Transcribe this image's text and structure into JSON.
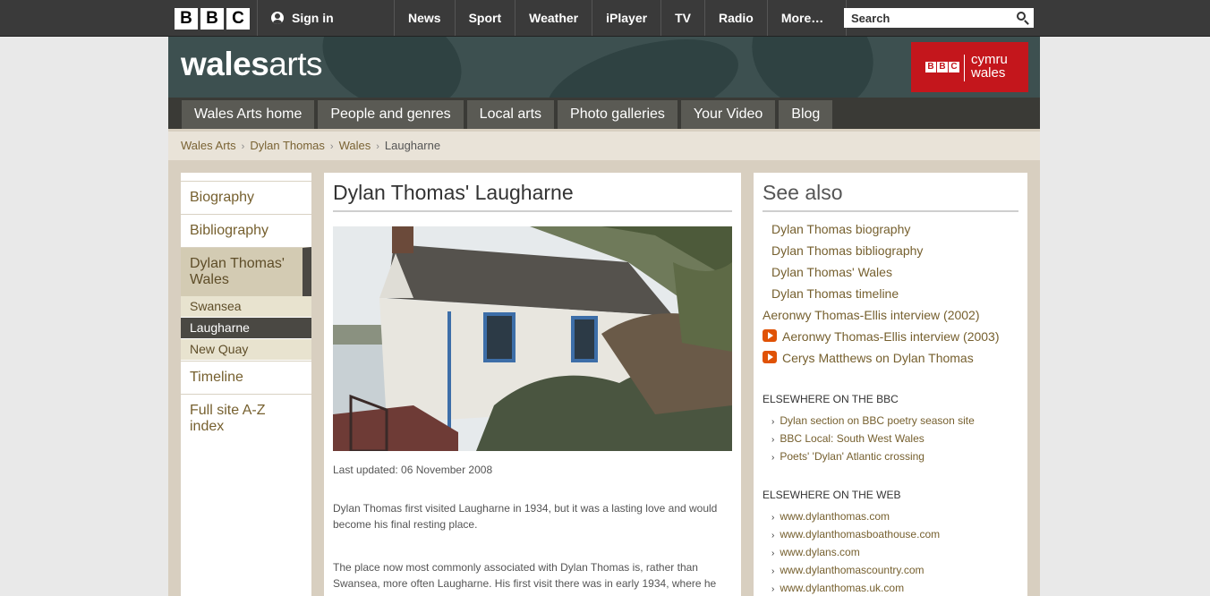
{
  "global": {
    "logo": [
      "B",
      "B",
      "C"
    ],
    "signin": "Sign in",
    "nav": [
      "News",
      "Sport",
      "Weather",
      "iPlayer",
      "TV",
      "Radio",
      "More…"
    ],
    "search_placeholder": "Search"
  },
  "banner": {
    "title_bold": "wales",
    "title_light": "arts",
    "cymru_logo": [
      "B",
      "B",
      "C"
    ],
    "cymru_line1": "cymru",
    "cymru_line2": "wales"
  },
  "nav": [
    "Wales Arts home",
    "People and genres",
    "Local arts",
    "Photo galleries",
    "Your Video",
    "Blog"
  ],
  "breadcrumb": {
    "links": [
      "Wales Arts",
      "Dylan Thomas",
      "Wales"
    ],
    "separator": "›",
    "current": "Laugharne"
  },
  "leftnav": {
    "items": [
      "Biography",
      "Bibliography"
    ],
    "active": "Dylan Thomas' Wales",
    "subitems": [
      "Swansea",
      "Laugharne",
      "New Quay"
    ],
    "after": [
      "Timeline",
      "Full site A-Z index"
    ]
  },
  "main": {
    "title": "Dylan Thomas' Laugharne",
    "updated": "Last updated: 06 November 2008",
    "para1": "Dylan Thomas first visited Laugharne in 1934, but it was a lasting love and would become his final resting place.",
    "para2": "The place now most commonly associated with Dylan Thomas is, rather than Swansea, more often Laugharne. His first visit there was in early 1934, where he"
  },
  "see_also": {
    "title": "See also",
    "links": [
      "Dylan Thomas biography",
      "Dylan Thomas bibliography",
      "Dylan Thomas' Wales",
      "Dylan Thomas timeline",
      "Aeronwy Thomas-Ellis interview (2002)"
    ],
    "video_links": [
      "Aeronwy Thomas-Ellis interview (2003)",
      "Cerys Matthews on Dylan Thomas"
    ],
    "bbc_head": "ELSEWHERE ON THE BBC",
    "bbc_links": [
      "Dylan section on BBC poetry season site",
      "BBC Local: South West Wales",
      "Poets' 'Dylan' Atlantic crossing"
    ],
    "web_head": "ELSEWHERE ON THE WEB",
    "web_links": [
      "www.dylanthomas.com",
      "www.dylanthomasboathouse.com",
      "www.dylans.com",
      "www.dylanthomascountry.com",
      "www.dylanthomas.uk.com"
    ],
    "chevron": "›"
  },
  "colors": {
    "accent_link": "#76602f",
    "global_bar": "#3a3a3a",
    "banner": "#3d5050",
    "cymru_red": "#c4161c",
    "video_icon": "#e05206"
  }
}
